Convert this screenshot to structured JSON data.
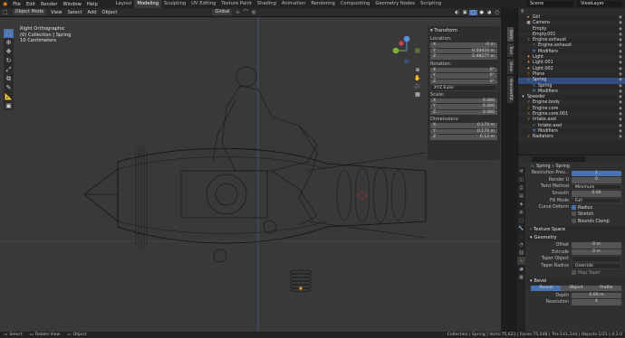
{
  "top_menu": [
    "File",
    "Edit",
    "Render",
    "Window",
    "Help"
  ],
  "workspaces": [
    "Layout",
    "Modeling",
    "Sculpting",
    "UV Editing",
    "Texture Paint",
    "Shading",
    "Animation",
    "Rendering",
    "Compositing",
    "Geometry Nodes",
    "Scripting"
  ],
  "active_workspace": "Modeling",
  "scene": "Scene",
  "view_layer": "ViewLayer",
  "header": {
    "mode": "Object Mode",
    "menus": [
      "View",
      "Select",
      "Add",
      "Object"
    ],
    "orientation": "Global"
  },
  "viewport_info": {
    "view": "Right Orthographic",
    "collection": "(0) Collection | Spring",
    "scale": "10 Centimeters"
  },
  "npanel": {
    "title": "Transform",
    "location_label": "Location:",
    "location": [
      {
        "axis": "X",
        "value": "-0 m"
      },
      {
        "axis": "Y",
        "value": "0.50424 m"
      },
      {
        "axis": "Z",
        "value": "0.48277 m"
      }
    ],
    "rotation_label": "Rotation:",
    "rotation": [
      {
        "axis": "X",
        "value": "0°"
      },
      {
        "axis": "Y",
        "value": "0°"
      },
      {
        "axis": "Z",
        "value": "0°"
      }
    ],
    "euler": "XYZ Euler",
    "scale_label": "Scale:",
    "scale": [
      {
        "axis": "X",
        "value": "0.080"
      },
      {
        "axis": "Y",
        "value": "0.080"
      },
      {
        "axis": "Z",
        "value": "0.080"
      }
    ],
    "dimensions_label": "Dimensions:",
    "dimensions": [
      {
        "axis": "X",
        "value": "0.174 m"
      },
      {
        "axis": "Y",
        "value": "0.174 m"
      },
      {
        "axis": "Z",
        "value": "0.13 m"
      }
    ]
  },
  "ntabs": [
    "Item",
    "Tool",
    "View",
    "BlenderKit"
  ],
  "outliner": [
    {
      "indent": 1,
      "icon": "▸",
      "label": "Girl",
      "color": "#e8a040"
    },
    {
      "indent": 1,
      "icon": "■",
      "label": "Camera",
      "color": "#a0a0a0"
    },
    {
      "indent": 1,
      "icon": "·",
      "label": "Empty",
      "color": "#a0a0a0"
    },
    {
      "indent": 1,
      "icon": "·",
      "label": "Empty.001",
      "color": "#a0a0a0"
    },
    {
      "indent": 1,
      "icon": "▿",
      "label": "Engine.exhaust",
      "color": "#e8a040"
    },
    {
      "indent": 2,
      "icon": "▿",
      "label": "Engine.exhaust",
      "color": "#40c0a0"
    },
    {
      "indent": 2,
      "icon": "⚒",
      "label": "Modifiers",
      "color": "#6090e0"
    },
    {
      "indent": 1,
      "icon": "✦",
      "label": "Light",
      "color": "#e8a040"
    },
    {
      "indent": 1,
      "icon": "✦",
      "label": "Light.001",
      "color": "#e8a040"
    },
    {
      "indent": 1,
      "icon": "✦",
      "label": "Light.002",
      "color": "#e8a040"
    },
    {
      "indent": 1,
      "icon": "▿",
      "label": "Plane",
      "color": "#e8a040"
    },
    {
      "indent": 1,
      "icon": "▿",
      "label": "Spring",
      "color": "#e8a040",
      "selected": true
    },
    {
      "indent": 2,
      "icon": "∿",
      "label": "Spring",
      "color": "#40c0a0"
    },
    {
      "indent": 2,
      "icon": "⚒",
      "label": "Modifiers",
      "color": "#6090e0"
    },
    {
      "indent": 0,
      "icon": "▾",
      "label": "Speeder",
      "color": "#e0e0e0"
    },
    {
      "indent": 1,
      "icon": "▿",
      "label": "Engine.body",
      "color": "#e8a040"
    },
    {
      "indent": 1,
      "icon": "▿",
      "label": "Engine.core",
      "color": "#e8a040"
    },
    {
      "indent": 1,
      "icon": "▿",
      "label": "Engine.core.001",
      "color": "#e8a040"
    },
    {
      "indent": 1,
      "icon": "▿",
      "label": "Intake.axel",
      "color": "#e8a040"
    },
    {
      "indent": 2,
      "icon": "▿",
      "label": "Intake.axel",
      "color": "#40c0a0"
    },
    {
      "indent": 2,
      "icon": "⚒",
      "label": "Modifiers",
      "color": "#6090e0"
    },
    {
      "indent": 1,
      "icon": "▿",
      "label": "Radiators",
      "color": "#e8a040"
    }
  ],
  "properties": {
    "object_name": "Spring",
    "data_name": "Spring",
    "resolution_preview_label": "Resolution Prev...",
    "resolution_preview": "1",
    "render_u_label": "Render U",
    "render_u": "0",
    "twist_method_label": "Twist Method",
    "twist_method": "Minimum",
    "smooth_label": "Smooth",
    "smooth": "0.00",
    "fill_mode_label": "Fill Mode",
    "fill_mode": "Full",
    "curve_deform_label": "Curve Deform",
    "radius_label": "Radius",
    "stretch_label": "Stretch",
    "bounds_clamp_label": "Bounds Clamp",
    "texture_space_label": "Texture Space",
    "geometry_label": "Geometry",
    "offset_label": "Offset",
    "offset": "0 m",
    "extrude_label": "Extrude",
    "extrude": "0 m",
    "taper_object_label": "Taper Object",
    "taper_radius_label": "Taper Radius",
    "taper_radius": "Override",
    "map_taper_label": "Map Taper",
    "bevel_label": "Bevel",
    "bevel_modes": [
      "Round",
      "Object",
      "Profile"
    ],
    "depth_label": "Depth",
    "depth": "0.09 m",
    "resolution_label": "Resolution",
    "resolution": "4"
  },
  "status": {
    "left": [
      "Select",
      "Rotate View",
      "Object"
    ],
    "right": "Collection | Spring | Verts:75,621 | Faces:75,548 | Tris:141,244 | Objects:1/21 | 4.3.0"
  }
}
